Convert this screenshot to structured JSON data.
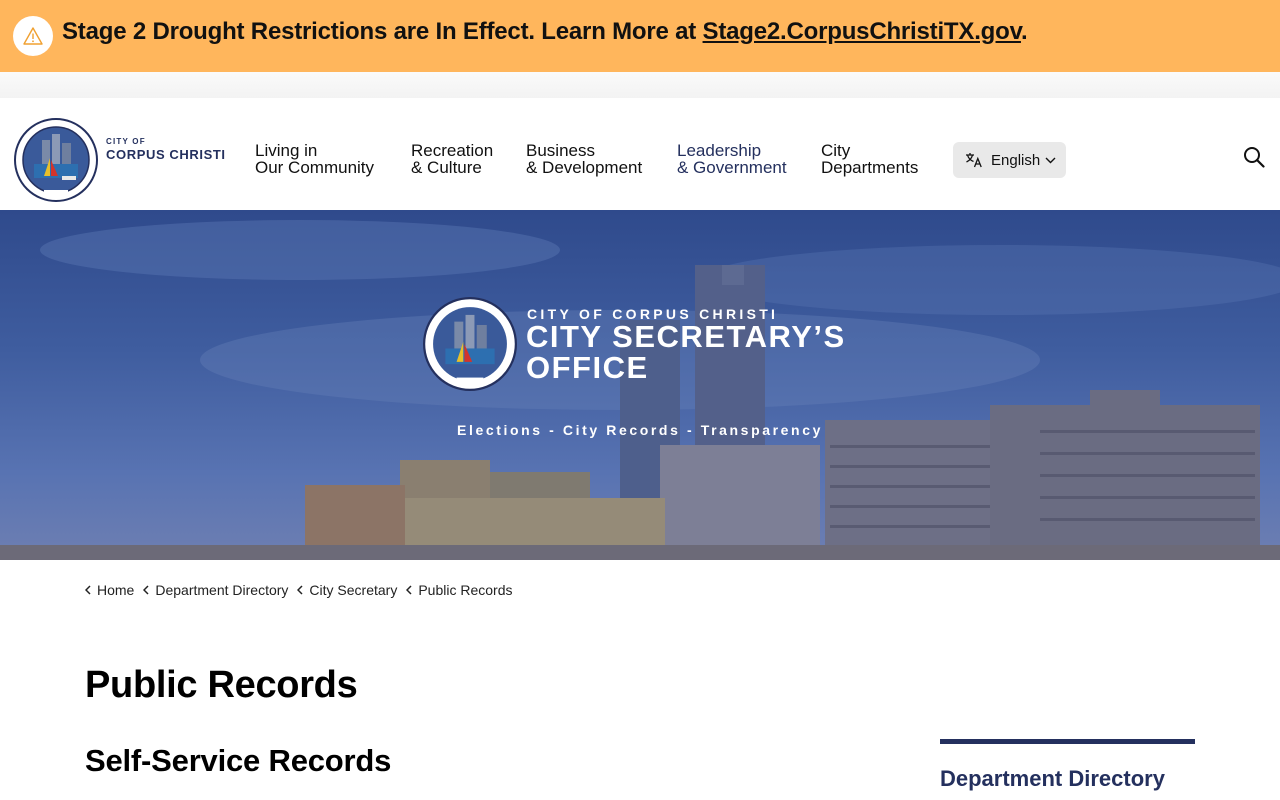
{
  "alert": {
    "prefix": "Stage 2 Drought Restrictions are In Effect. Learn More at ",
    "link": "Stage2.CorpusChristiTX.gov",
    "suffix": ".",
    "icon": "warning-triangle-icon",
    "background": "#ffb65c"
  },
  "header": {
    "logo": {
      "line1": "CITY OF",
      "line2": "CORPUS CHRISTI",
      "seal_year": "1852"
    },
    "nav": [
      {
        "line1": "Living in",
        "line2": "Our Community"
      },
      {
        "line1": "Recreation",
        "line2": "& Culture"
      },
      {
        "line1": "Business",
        "line2": "& Development"
      },
      {
        "line1": "Leadership",
        "line2": "& Government"
      },
      {
        "line1": "City",
        "line2": "Departments"
      }
    ],
    "language": "English",
    "brand_color": "#24305e"
  },
  "hero": {
    "subtitle": "CITY OF CORPUS CHRISTI",
    "title": "CITY SECRETARY’S OFFICE",
    "tagline": "Elections - City Records - Transparency"
  },
  "breadcrumbs": [
    "Home",
    "Department Directory",
    "City Secretary",
    "Public Records"
  ],
  "main": {
    "title": "Public Records",
    "section_title": "Self-Service Records"
  },
  "sidebar": {
    "title": "Department Directory"
  }
}
